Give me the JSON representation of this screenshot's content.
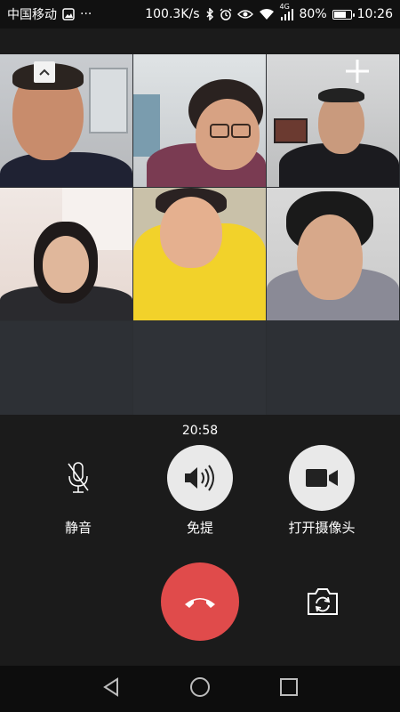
{
  "status_bar": {
    "carrier": "中国移动",
    "more": "···",
    "net_speed": "100.3K/s",
    "net_type": "4G",
    "battery": "80%",
    "battery_level": 0.8,
    "time": "10:26",
    "icons": [
      "image-icon",
      "bluetooth-icon",
      "alarm-icon",
      "eye-icon",
      "wifi-icon",
      "signal-icon",
      "battery-icon"
    ]
  },
  "call": {
    "participants_count": 6,
    "duration": "20:58"
  },
  "controls": {
    "mute_label": "静音",
    "speaker_label": "免提",
    "camera_label": "打开摄像头"
  },
  "colors": {
    "hangup": "#e04b4b",
    "control_circle": "#e9e9e9",
    "background": "#1b1b1b",
    "grid_background": "#2b2e32"
  },
  "nav": [
    "back-icon",
    "home-icon",
    "recents-icon"
  ]
}
